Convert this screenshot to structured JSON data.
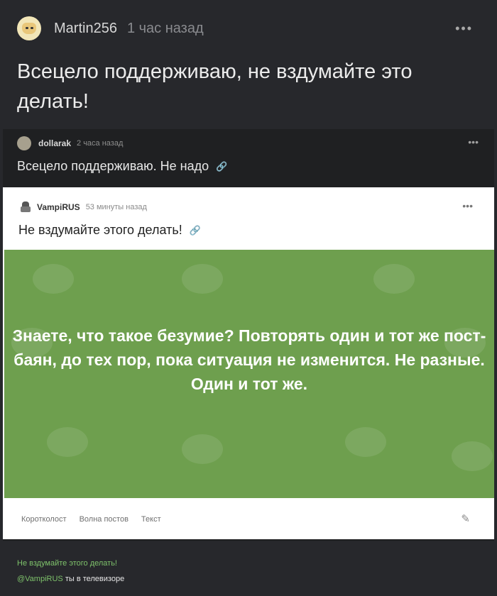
{
  "post": {
    "author": "Martin256",
    "time": "1 час назад",
    "title": "Всецело поддерживаю, не вздумайте это делать!"
  },
  "screenshot": {
    "comment1": {
      "author": "dollarak",
      "time": "2 часа назад",
      "text": "Всецело поддерживаю. Не надо"
    },
    "comment2": {
      "author": "VampiRUS",
      "time": "53 минуты назад",
      "text": "Не вздумайте этого делать!"
    },
    "image_text": "Знаете, что такое безумие? Повторять один и тот же пост-баян, до тех пор, пока ситуация не изменится. Не разные. Один и тот же.",
    "tags": [
      "Коротколост",
      "Волна постов",
      "Текст"
    ],
    "green_color": "#6e9f4e"
  },
  "footer": {
    "line1": "Не вздумайте этого делать!",
    "mention": "@VampiRUS",
    "line2_rest": " ты в телевизоре"
  },
  "icons": [
    "more-icon",
    "link-icon",
    "pencil-icon"
  ]
}
